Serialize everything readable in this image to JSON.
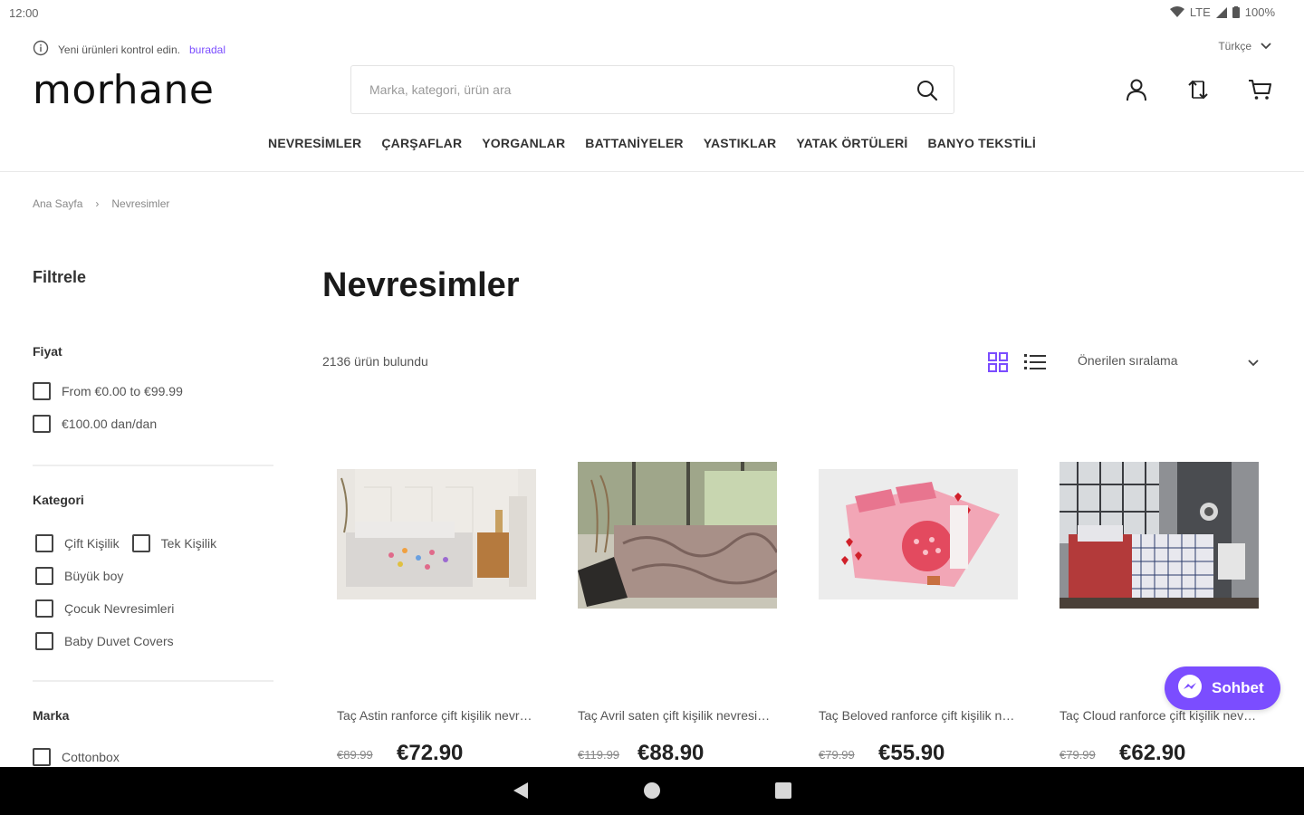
{
  "status_bar": {
    "time": "12:00",
    "network": "LTE",
    "battery": "100%"
  },
  "notice": {
    "text": "Yeni ürünleri kontrol edin.",
    "link": "buradal"
  },
  "language": {
    "selected": "Türkçe"
  },
  "logo": {
    "text": "morhane"
  },
  "search": {
    "placeholder": "Marka, kategori, ürün ara"
  },
  "icons": {
    "search": "search-icon",
    "account": "user-icon",
    "compare": "compare-icon",
    "cart": "cart-icon"
  },
  "nav": {
    "items": [
      "NEVRESİMLER",
      "ÇARŞAFLAR",
      "YORGANLAR",
      "BATTANİYELER",
      "YASTIKLAR",
      "YATAK ÖRTÜLERİ",
      "BANYO TEKSTİLİ"
    ]
  },
  "breadcrumb": {
    "home": "Ana Sayfa",
    "separator": "›",
    "current": "Nevresimler"
  },
  "sidebar": {
    "title": "Filtrele",
    "price": {
      "title": "Fiyat",
      "options": [
        "From €0.00 to €99.99",
        "€100.00 dan/dan"
      ]
    },
    "category": {
      "title": "Kategori",
      "options": [
        "Çift Kişilik",
        "Tek Kişilik",
        "Büyük boy",
        "Çocuk Nevresimleri",
        "Baby Duvet Covers"
      ]
    },
    "brand": {
      "title": "Marka",
      "options": [
        "Cottonbox"
      ]
    }
  },
  "main": {
    "title": "Nevresimler",
    "result_count": "2136 ürün bulundu",
    "sort": {
      "selected": "Önerilen sıralama"
    }
  },
  "products": [
    {
      "name": "Taç Astin ranforce çift kişilik nevresim takımı",
      "old_price": "€89.99",
      "price": "€72.90"
    },
    {
      "name": "Taç Avril saten çift kişilik nevresim takımı",
      "old_price": "€119.99",
      "price": "€88.90"
    },
    {
      "name": "Taç Beloved ranforce çift kişilik nevresim takımı",
      "old_price": "€79.99",
      "price": "€55.90"
    },
    {
      "name": "Taç Cloud ranforce çift kişilik nevresim takımı",
      "old_price": "€79.99",
      "price": "€62.90"
    }
  ],
  "chat": {
    "label": "Sohbet"
  },
  "colors": {
    "accent": "#7b4dff",
    "text": "#1a1a1a",
    "muted": "#888888",
    "navbar": "#000000"
  }
}
